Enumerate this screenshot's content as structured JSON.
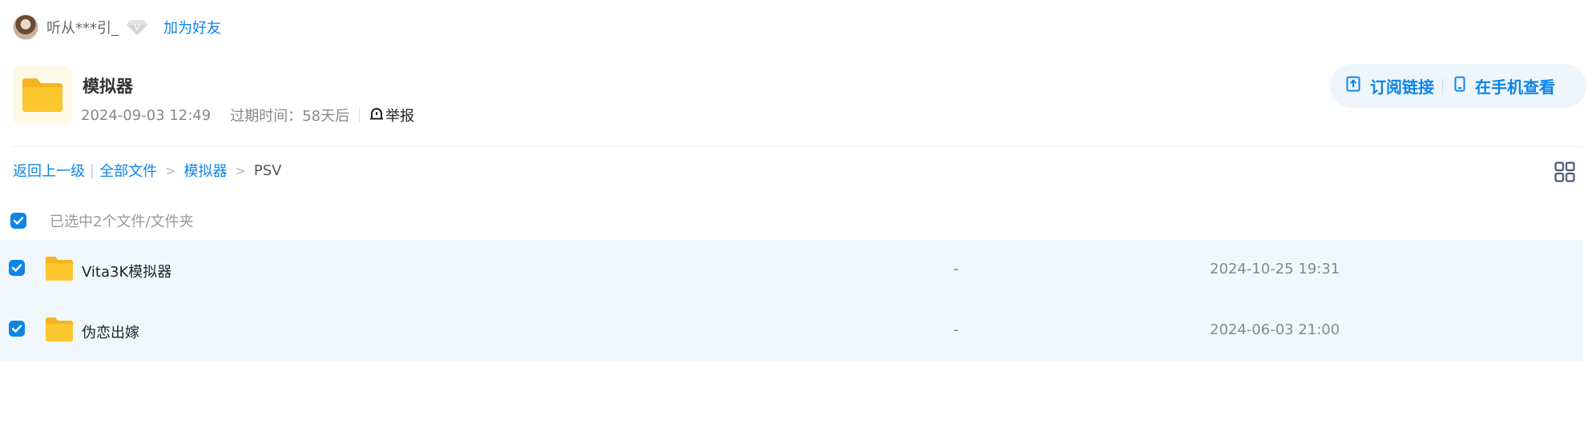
{
  "user": {
    "nickname": "听从***引_",
    "vip_badge": "V",
    "add_friend": "加为好友"
  },
  "share": {
    "title": "模拟器",
    "date": "2024-09-03 12:49",
    "expire": "过期时间：58天后",
    "report": "举报",
    "actions": {
      "subscribe": "订阅链接",
      "mobile_view": "在手机查看"
    }
  },
  "breadcrumb": {
    "back": "返回上一级",
    "all_files": "全部文件",
    "folder": "模拟器",
    "current": "PSV",
    "separator": ">"
  },
  "selection": {
    "summary": "已选中2个文件/文件夹"
  },
  "files": [
    {
      "name": "Vita3K模拟器",
      "size": "-",
      "date": "2024-10-25 19:31",
      "checked": true
    },
    {
      "name": "伪恋出嫁",
      "size": "-",
      "date": "2024-06-03 21:00",
      "checked": true
    }
  ],
  "colors": {
    "accent": "#0d84e8",
    "row_selected_bg": "#f1f8fd",
    "folder_yellow": "#fdc72f",
    "action_pill_bg": "#eef6fc"
  },
  "icons": {
    "vip": "diamond-icon",
    "report": "alarm-bell-icon",
    "subscribe": "upload-square-icon",
    "mobile": "phone-icon",
    "view_mode": "grid-icon",
    "folder": "folder-icon",
    "check": "check-icon"
  }
}
